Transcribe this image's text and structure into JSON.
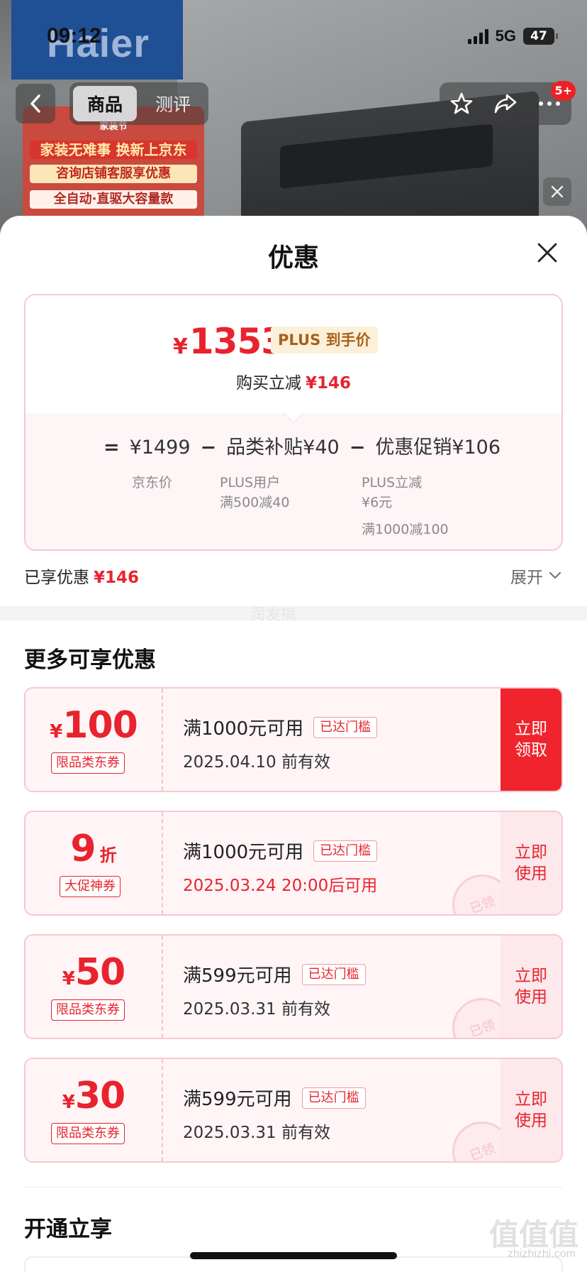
{
  "status_bar": {
    "time": "09:12",
    "network": "5G",
    "battery": "47"
  },
  "background": {
    "brand_logo": "Haier",
    "promo_lines": [
      "家装节",
      "家装无难事 换新上京东",
      "咨询店铺客服享优惠",
      "全自动·直驱大容量款"
    ]
  },
  "nav": {
    "tabs": [
      {
        "label": "商品",
        "active": true
      },
      {
        "label": "测评",
        "active": false
      }
    ],
    "actions": [
      "star-icon",
      "share-icon",
      "more-icon"
    ],
    "badge": "5+"
  },
  "sheet": {
    "title": "优惠",
    "price_card": {
      "currency": "¥",
      "final_price": "1353",
      "plus_tag": "PLUS 到手价",
      "reduce_label": "购买立减",
      "reduce_value": "¥146",
      "formula": {
        "equals": "=",
        "base": "¥1499",
        "minus": "−",
        "item1": "品类补贴¥40",
        "item2": "优惠促销¥106"
      },
      "base_caption": "京东价",
      "item1_captions": [
        "PLUS用户",
        "满500减40"
      ],
      "item2_captions": [
        "PLUS立减",
        "¥6元",
        "满1000减100"
      ]
    },
    "enjoyed_label": "已享优惠",
    "enjoyed_value": "¥146",
    "expand_label": "展开",
    "more_title": "更多可享优惠",
    "coupons": [
      {
        "currency": "¥",
        "amount": "100",
        "unit": "",
        "type": "限品类东券",
        "condition": "满1000元可用",
        "reached": "已达门槛",
        "validity": "2025.04.10 前有效",
        "validity_red": false,
        "cta": "立即\n领取",
        "cta_solid": true,
        "stamp": ""
      },
      {
        "currency": "",
        "amount": "9",
        "unit": "折",
        "type": "大促神券",
        "condition": "满1000元可用",
        "reached": "已达门槛",
        "validity": "2025.03.24 20:00后可用",
        "validity_red": true,
        "cta": "立即\n使用",
        "cta_solid": false,
        "stamp": "已领"
      },
      {
        "currency": "¥",
        "amount": "50",
        "unit": "",
        "type": "限品类东券",
        "condition": "满599元可用",
        "reached": "已达门槛",
        "validity": "2025.03.31 前有效",
        "validity_red": false,
        "cta": "立即\n使用",
        "cta_solid": false,
        "stamp": "已领"
      },
      {
        "currency": "¥",
        "amount": "30",
        "unit": "",
        "type": "限品类东券",
        "condition": "满599元可用",
        "reached": "已达门槛",
        "validity": "2025.03.31 前有效",
        "validity_red": false,
        "cta": "立即\n使用",
        "cta_solid": false,
        "stamp": "已领"
      }
    ],
    "open_title": "开通立享"
  },
  "watermark": {
    "main": "值值值",
    "sub": "zhizhizhi.com",
    "mid": "润发搞"
  },
  "colors": {
    "accent_red": "#e8232d",
    "plus_gold": "#a8621c",
    "border_pink": "#f7c9cf"
  }
}
